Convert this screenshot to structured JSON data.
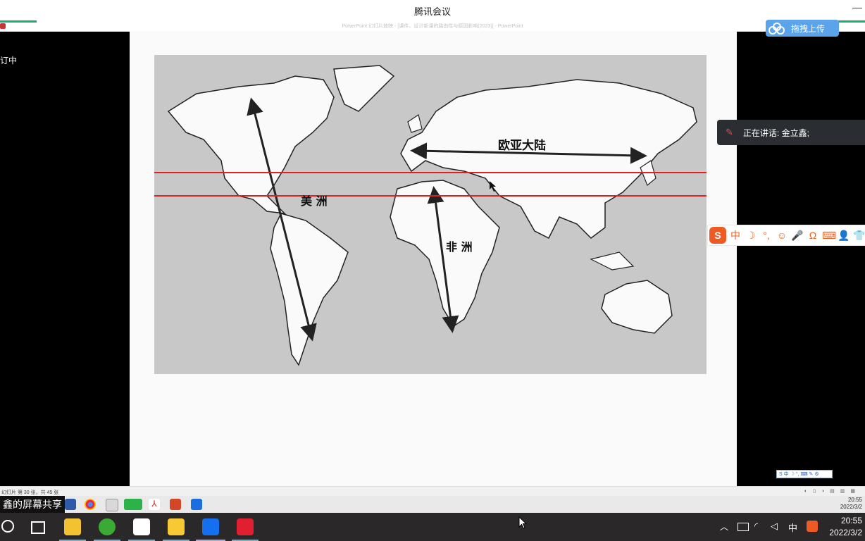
{
  "window": {
    "title": "腾讯会议",
    "subtitle": "PowerPoint 幻灯片放映 - [课件、设计新课的路由性与原因影响(2023)] - PowerPoint",
    "minimize": "—"
  },
  "upload_button": {
    "label": "拖拽上传",
    "icon": "cloud-icon"
  },
  "left_label": "订中",
  "speaking": {
    "text": "正在讲话: 金立鑫;",
    "icon": "muted-mic-icon"
  },
  "ime": {
    "logo": "S",
    "items": [
      "中",
      "☽",
      "°,",
      "☺",
      "🎤",
      "Ω",
      "⌨",
      "👤",
      "👕"
    ]
  },
  "mini_ime": "S 中 ☽ °, ⌨ ✎ ⚙",
  "map": {
    "labels": {
      "eurasia": "欧亚大陆",
      "americas": "美 洲",
      "africa": "非 洲"
    }
  },
  "statusbar": {
    "text": "幻灯片 第 30 张，共 45 张"
  },
  "share_label": "鑫的屏幕共享",
  "inner_clock": {
    "time": "20:55",
    "date": "2022/3/2"
  },
  "taskbar": {
    "tray_lang": "中",
    "time": "20:55",
    "date": "2022/3/2"
  },
  "colors": {
    "green_accent": "#1aad6e",
    "upload_blue": "#5ba3ea",
    "red_line": "#e02020"
  }
}
